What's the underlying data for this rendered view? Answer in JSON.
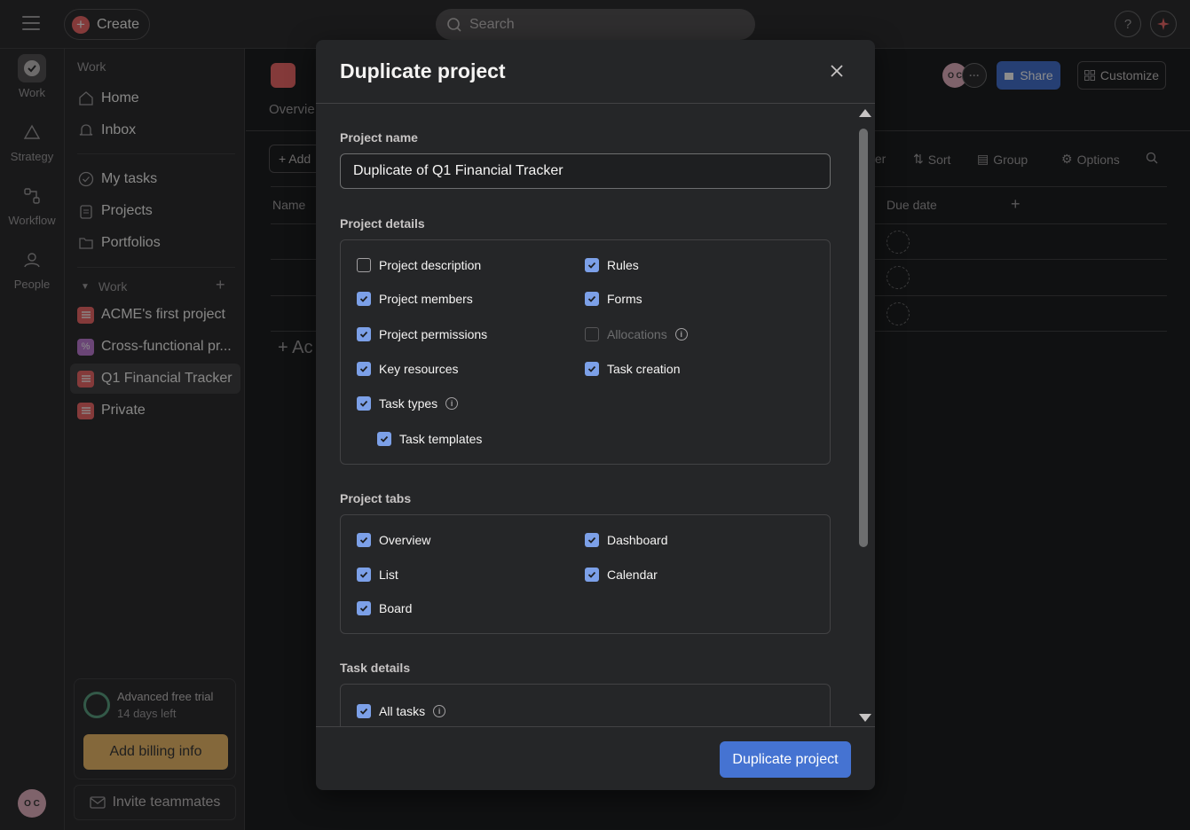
{
  "topbar": {
    "create_label": "Create",
    "search_placeholder": "Search",
    "help_label": "?"
  },
  "rail": {
    "items": [
      {
        "label": "Work",
        "icon": "check-circle-icon"
      },
      {
        "label": "Strategy",
        "icon": "triangle-icon"
      },
      {
        "label": "Workflow",
        "icon": "workflow-icon"
      },
      {
        "label": "People",
        "icon": "people-icon"
      }
    ],
    "avatar_initials": "O C"
  },
  "sidebar": {
    "section_title": "Work",
    "nav": [
      {
        "label": "Home",
        "icon": "home-icon"
      },
      {
        "label": "Inbox",
        "icon": "bell-icon"
      },
      {
        "label": "My tasks",
        "icon": "check-circle-icon"
      },
      {
        "label": "Projects",
        "icon": "clipboard-icon"
      },
      {
        "label": "Portfolios",
        "icon": "folder-icon"
      }
    ],
    "work_section": "Work",
    "projects": [
      {
        "label": "ACME's first project",
        "color": "#f06a6a"
      },
      {
        "label": "Cross-functional pr...",
        "color": "#c17ed8"
      },
      {
        "label": "Q1 Financial Tracker",
        "color": "#f06a6a",
        "active": true
      },
      {
        "label": "Private",
        "color": "#f06a6a"
      }
    ],
    "trial_title": "Advanced free trial",
    "trial_sub": "14 days left",
    "billing_label": "Add billing info",
    "invite_label": "Invite teammates"
  },
  "main": {
    "tab_overview": "Overvie",
    "add_label": "+ Add",
    "col_name": "Name",
    "add_section": "+ Ac",
    "share_label": "Share",
    "customize_label": "Customize",
    "avatar_initials": "O C",
    "toolbar": [
      "ter",
      "Sort",
      "Group",
      "Options"
    ],
    "col_due": "Due date"
  },
  "modal": {
    "title": "Duplicate project",
    "project_name_label": "Project name",
    "project_name_value": "Duplicate of Q1 Financial Tracker",
    "details_label": "Project details",
    "details": {
      "project_description": {
        "label": "Project description",
        "checked": false
      },
      "project_members": {
        "label": "Project members",
        "checked": true
      },
      "project_permissions": {
        "label": "Project permissions",
        "checked": true
      },
      "key_resources": {
        "label": "Key resources",
        "checked": true
      },
      "task_types": {
        "label": "Task types",
        "checked": true
      },
      "task_templates": {
        "label": "Task templates",
        "checked": true
      },
      "rules": {
        "label": "Rules",
        "checked": true
      },
      "forms": {
        "label": "Forms",
        "checked": true
      },
      "allocations": {
        "label": "Allocations",
        "checked": false,
        "disabled": true
      },
      "task_creation": {
        "label": "Task creation",
        "checked": true
      }
    },
    "tabs_label": "Project tabs",
    "tabs": {
      "overview": {
        "label": "Overview",
        "checked": true
      },
      "list": {
        "label": "List",
        "checked": true
      },
      "board": {
        "label": "Board",
        "checked": true
      },
      "dashboard": {
        "label": "Dashboard",
        "checked": true
      },
      "calendar": {
        "label": "Calendar",
        "checked": true
      }
    },
    "task_details_label": "Task details",
    "task_details": {
      "all_tasks": {
        "label": "All tasks",
        "checked": true
      }
    },
    "submit_label": "Duplicate project"
  },
  "colors": {
    "accent": "#4573d2",
    "checkbox": "#7ca0e8",
    "modal_bg": "#252628",
    "trial_ring": "#5da283",
    "billing": "#f1bd6c"
  }
}
